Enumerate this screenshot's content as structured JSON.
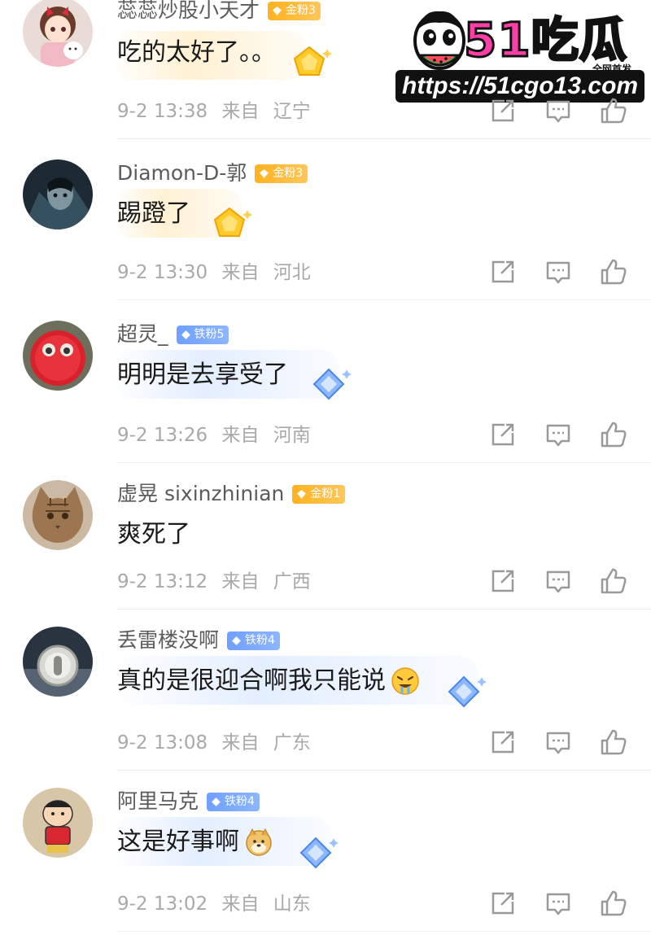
{
  "watermark": {
    "brand": "51吃瓜",
    "tagline": "全网首发",
    "url": "https://51cgo13.com"
  },
  "colors": {
    "gold_badge": "#ffb21e",
    "iron_badge": "#6fa0ff",
    "meta_text": "#a9a9a9",
    "username_text": "#5b5b5b",
    "watermark_pink": "#ff3fa8"
  },
  "comments": [
    {
      "username": "蕊蕊炒股小天才",
      "badge": {
        "label": "金粉3",
        "tier": "gold"
      },
      "text": "吃的太好了。。",
      "emoji": null,
      "date": "9-2 13:38",
      "location_prefix": "来自",
      "location": "辽宁",
      "avatar_icon": "anime-girl-with-cat-avatar"
    },
    {
      "username": "Diamon-D-郭",
      "badge": {
        "label": "金粉3",
        "tier": "gold"
      },
      "text": "踢蹬了",
      "emoji": null,
      "date": "9-2 13:30",
      "location_prefix": "来自",
      "location": "河北",
      "avatar_icon": "dark-movie-character-avatar"
    },
    {
      "username": "超灵_",
      "badge": {
        "label": "铁粉5",
        "tier": "iron"
      },
      "text": "明明是去享受了",
      "emoji": null,
      "date": "9-2 13:26",
      "location_prefix": "来自",
      "location": "河南",
      "avatar_icon": "red-fluffy-monster-avatar"
    },
    {
      "username": "虚晃 sixinzhinian",
      "badge": {
        "label": "金粉1",
        "tier": "gold"
      },
      "text": "爽死了",
      "emoji": null,
      "date": "9-2 13:12",
      "location_prefix": "来自",
      "location": "广西",
      "avatar_icon": "tabby-cat-avatar"
    },
    {
      "username": "丢雷楼没啊",
      "badge": {
        "label": "铁粉4",
        "tier": "iron"
      },
      "text": "真的是很迎合啊我只能说",
      "emoji": "drooling-face-emoji",
      "date": "9-2 13:08",
      "location_prefix": "来自",
      "location": "广东",
      "avatar_icon": "keyhole-button-avatar"
    },
    {
      "username": "阿里马克",
      "badge": {
        "label": "铁粉4",
        "tier": "iron"
      },
      "text": "这是好事啊",
      "emoji": "doge-emoji",
      "date": "9-2 13:02",
      "location_prefix": "来自",
      "location": "山东",
      "avatar_icon": "cartoon-boy-avatar"
    }
  ]
}
